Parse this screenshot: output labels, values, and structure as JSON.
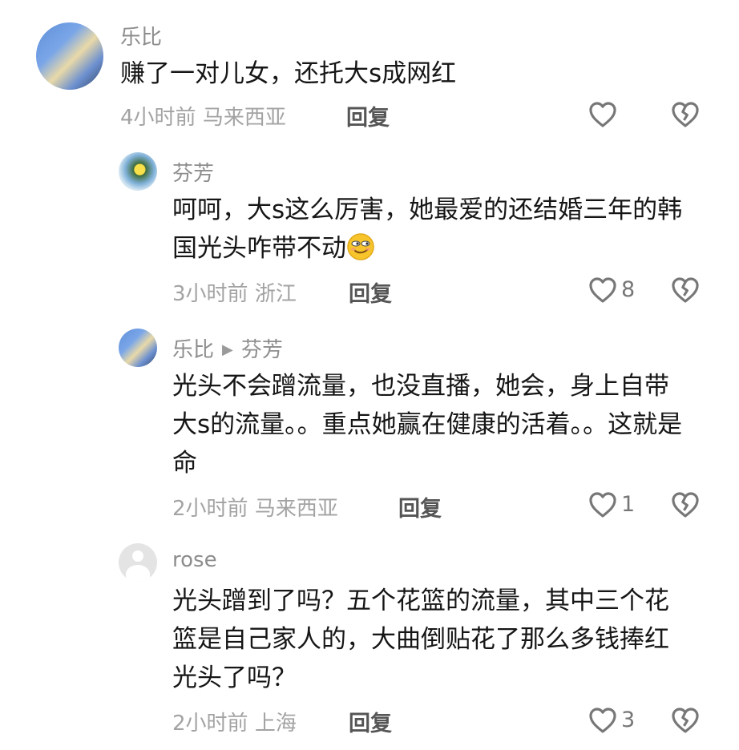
{
  "comments": [
    {
      "name": "乐比",
      "text": "赚了一对儿女，还托大s成网红",
      "time": "4小时前",
      "location": "马来西亚",
      "reply": "回复",
      "likes": ""
    },
    {
      "name": "芬芳",
      "text": "呵呵，大s这么厉害，她最爱的还结婚三年的韩国光头咋带不动",
      "time": "3小时前",
      "location": "浙江",
      "reply": "回复",
      "likes": "8"
    },
    {
      "name": "乐比",
      "reply_to": "芬芳",
      "text": "光头不会蹭流量，也没直播，她会，身上自带大s的流量。。重点她赢在健康的活着。。这就是命",
      "time": "2小时前",
      "location": "马来西亚",
      "reply": "回复",
      "likes": "1"
    },
    {
      "name": "rose",
      "text": "光头蹭到了吗？五个花篮的流量，其中三个花篮是自己家人的，大曲倒贴花了那么多钱捧红光头了吗？",
      "time": "2小时前",
      "location": "上海",
      "reply": "回复",
      "likes": "3"
    }
  ],
  "icons": {
    "like": "heart-outline-icon",
    "dislike": "broken-heart-icon",
    "reply_arrow": "play-arrow-icon",
    "emoji": "smirk-face-emoji"
  }
}
